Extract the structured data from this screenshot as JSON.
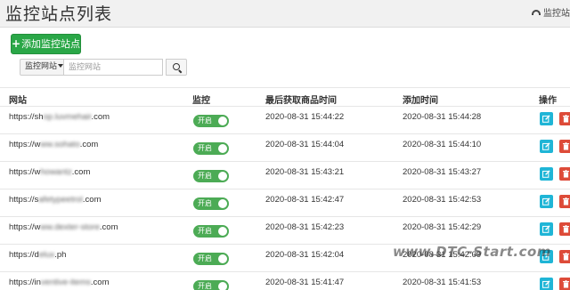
{
  "header": {
    "title": "监控站点列表",
    "breadcrumb": "监控站",
    "breadcrumb_icon": "dashboard-icon"
  },
  "toolbar": {
    "add_button": "添加监控站点",
    "search_type": "监控网站",
    "search_placeholder": "监控网站"
  },
  "table": {
    "columns": [
      "网站",
      "监控",
      "最后获取商品时间",
      "添加时间",
      "操作"
    ],
    "rows": [
      {
        "url_prefix": "https://sh",
        "url_blur": "op.luvmehair",
        "url_suffix": ".com",
        "status": "开启",
        "last_fetch": "2020-08-31 15:44:22",
        "added": "2020-08-31 15:44:28"
      },
      {
        "url_prefix": "https://w",
        "url_blur": "ww.sohato",
        "url_suffix": ".com",
        "status": "开启",
        "last_fetch": "2020-08-31 15:44:04",
        "added": "2020-08-31 15:44:10"
      },
      {
        "url_prefix": "https://w",
        "url_blur": "howantz",
        "url_suffix": ".com",
        "status": "开启",
        "last_fetch": "2020-08-31 15:43:21",
        "added": "2020-08-31 15:43:27"
      },
      {
        "url_prefix": "https://s",
        "url_blur": "afetypeetrol",
        "url_suffix": ".com",
        "status": "开启",
        "last_fetch": "2020-08-31 15:42:47",
        "added": "2020-08-31 15:42:53"
      },
      {
        "url_prefix": "https://w",
        "url_blur": "ww.dexter-store",
        "url_suffix": ".com",
        "status": "开启",
        "last_fetch": "2020-08-31 15:42:23",
        "added": "2020-08-31 15:42:29"
      },
      {
        "url_prefix": "https://d",
        "url_blur": "elux",
        "url_suffix": ".ph",
        "status": "开启",
        "last_fetch": "2020-08-31 15:42:04",
        "added": "2020-08-31 15:42:09"
      },
      {
        "url_prefix": "https://in",
        "url_blur": "ventive-items",
        "url_suffix": ".com",
        "status": "开启",
        "last_fetch": "2020-08-31 15:41:47",
        "added": "2020-08-31 15:41:53"
      }
    ]
  },
  "watermark": "www.DTC-Start.com",
  "colors": {
    "add_button": "#2aa747",
    "toggle_on": "#4cab55",
    "edit_button": "#1fb5d6",
    "delete_button": "#dd4b39"
  }
}
